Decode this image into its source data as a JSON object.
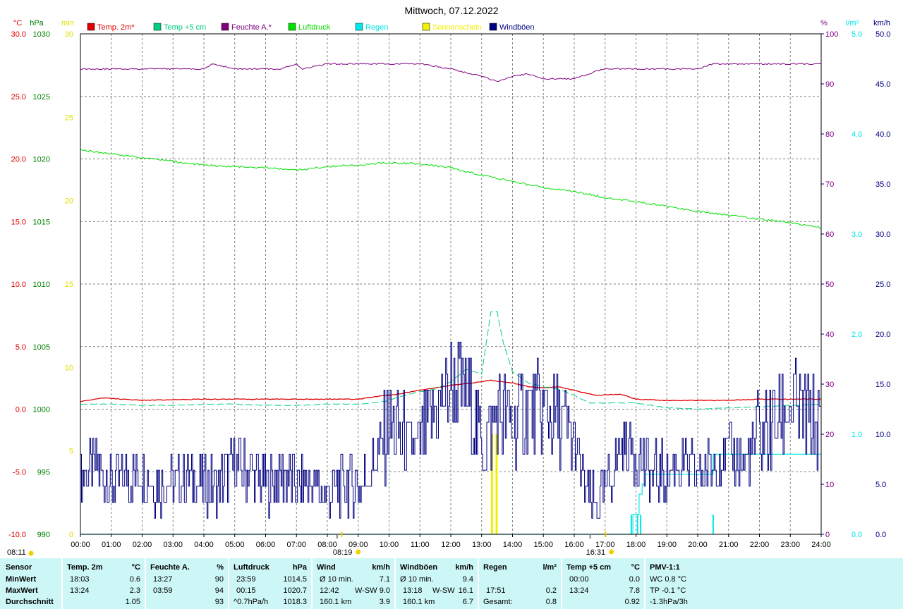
{
  "title": "Mittwoch, 07.12.2022",
  "legend": [
    {
      "name": "Temp. 2m*",
      "color": "#e00000"
    },
    {
      "name": "Temp +5 cm",
      "color": "#00d080"
    },
    {
      "name": "Feuchte A.*",
      "color": "#800080"
    },
    {
      "name": "Luftdruck",
      "color": "#00e000"
    },
    {
      "name": "Regen",
      "color": "#00e8e8"
    },
    {
      "name": "Sonnenschein",
      "color": "#f0f000"
    },
    {
      "name": "Windböen",
      "color": "#000080"
    }
  ],
  "chart_data": {
    "type": "line",
    "title": "Mittwoch, 07.12.2022",
    "x_ticks": [
      "00:00",
      "01:00",
      "02:00",
      "03:00",
      "04:00",
      "05:00",
      "06:00",
      "07:00",
      "08:00",
      "09:00",
      "10:00",
      "11:00",
      "12:00",
      "13:00",
      "14:00",
      "15:00",
      "16:00",
      "17:00",
      "18:00",
      "19:00",
      "20:00",
      "21:00",
      "22:00",
      "23:00",
      "24:00"
    ],
    "axes": {
      "temp": {
        "unit": "°C",
        "range": [
          -10,
          30
        ],
        "ticks": [
          "-10.0",
          "-5.0",
          "0.0",
          "5.0",
          "10.0",
          "15.0",
          "20.0",
          "25.0",
          "30.0"
        ],
        "color": "#e00000"
      },
      "pressure": {
        "unit": "hPa",
        "range": [
          990,
          1030
        ],
        "ticks": [
          "990",
          "995",
          "1000",
          "1005",
          "1010",
          "1015",
          "1020",
          "1025",
          "1030"
        ],
        "color": "#008000"
      },
      "sun": {
        "unit": "min",
        "range": [
          0,
          30
        ],
        "ticks": [
          "0",
          "5",
          "10",
          "15",
          "20",
          "25",
          "30"
        ],
        "color": "#e0e000"
      },
      "humidity": {
        "unit": "%",
        "range": [
          0,
          100
        ],
        "ticks": [
          "0",
          "10",
          "20",
          "30",
          "40",
          "50",
          "60",
          "70",
          "80",
          "90",
          "100"
        ],
        "color": "#800080"
      },
      "rain": {
        "unit": "l/m²",
        "range": [
          0,
          5
        ],
        "ticks": [
          "0.0",
          "1.0",
          "2.0",
          "3.0",
          "4.0",
          "5.0"
        ],
        "color": "#00e8e8"
      },
      "wind": {
        "unit": "km/h",
        "range": [
          0,
          50
        ],
        "ticks": [
          "0.0",
          "5.0",
          "10.0",
          "15.0",
          "20.0",
          "25.0",
          "30.0",
          "35.0",
          "40.0",
          "45.0",
          "50.0"
        ],
        "color": "#000080"
      }
    },
    "sunrise": "08:11",
    "sunset": "16:31",
    "sun_markers": [
      "08:19",
      "16:31"
    ],
    "grid": true,
    "legend_position": "top",
    "series": [
      {
        "name": "Feuchte A.*",
        "axis": "humidity",
        "color": "#800080",
        "x": [
          0,
          2,
          4,
          4.3,
          5,
          5.7,
          6.5,
          7,
          7.2,
          8,
          10,
          11,
          12,
          13,
          13.5,
          14,
          14.5,
          15,
          15.5,
          16,
          16.7,
          17,
          18,
          19,
          20,
          20.5,
          21,
          22,
          23,
          24
        ],
        "y": [
          93,
          93,
          93,
          94,
          93,
          93,
          93,
          94,
          93,
          94,
          94,
          94,
          93,
          91.5,
          90.5,
          91.5,
          92,
          91,
          91,
          91,
          92.5,
          93,
          93,
          93,
          93,
          94,
          94,
          94,
          94,
          94
        ]
      },
      {
        "name": "Luftdruck",
        "axis": "pressure",
        "color": "#00e000",
        "x": [
          0,
          1,
          2,
          3,
          4,
          5,
          6,
          7,
          8,
          9,
          10,
          11,
          12,
          13,
          14,
          15,
          16,
          17,
          18,
          19,
          20,
          21,
          22,
          23,
          24
        ],
        "y": [
          1020.7,
          1020.4,
          1020.1,
          1019.8,
          1019.5,
          1019.4,
          1019.3,
          1019.1,
          1019.4,
          1019.5,
          1019.7,
          1019.6,
          1019.3,
          1018.7,
          1018.2,
          1017.7,
          1017.4,
          1016.9,
          1016.6,
          1016.2,
          1015.8,
          1015.5,
          1015.2,
          1014.9,
          1014.5
        ]
      },
      {
        "name": "Temp. 2m*",
        "axis": "temp",
        "color": "#e00000",
        "x": [
          0,
          0.7,
          2,
          4,
          6,
          8,
          9,
          9.5,
          10,
          11,
          12,
          12.7,
          13.3,
          14,
          14.5,
          15,
          15.5,
          16,
          16.7,
          17.5,
          18,
          19,
          20,
          21,
          22,
          23,
          24
        ],
        "y": [
          0.6,
          0.9,
          0.7,
          0.8,
          0.8,
          0.8,
          0.8,
          1.0,
          1.1,
          1.5,
          1.9,
          2.1,
          2.3,
          2.1,
          1.8,
          1.7,
          1.8,
          1.5,
          1.1,
          1.2,
          0.8,
          0.7,
          0.7,
          0.7,
          0.8,
          0.8,
          0.8
        ]
      },
      {
        "name": "Temp +5 cm",
        "axis": "temp",
        "color": "#00d080",
        "dashed": true,
        "x": [
          0,
          1,
          2,
          3,
          4,
          5,
          6,
          7,
          8,
          9,
          9.5,
          10,
          10.5,
          11,
          11.5,
          12,
          12.5,
          13,
          13.3,
          13.5,
          13.7,
          14,
          14.5,
          15,
          15.5,
          16,
          16.5,
          17,
          18,
          19,
          20,
          21,
          22,
          23,
          24
        ],
        "y": [
          0.4,
          0.4,
          0.3,
          0.3,
          0.4,
          0.4,
          0.3,
          0.3,
          0.4,
          0.4,
          0.5,
          0.7,
          1.1,
          1.4,
          1.6,
          2.2,
          3.2,
          2.8,
          7.8,
          7.8,
          5.3,
          3.0,
          2.1,
          1.8,
          1.6,
          1.1,
          0.5,
          0.5,
          0.5,
          0.1,
          0.0,
          0.1,
          0.2,
          0.3,
          0.4
        ]
      },
      {
        "name": "Regen",
        "axis": "rain",
        "color": "#00e8e8",
        "x": [
          0,
          17.8,
          17.9,
          18.1,
          18.2,
          18.3,
          20.45,
          20.5,
          21,
          24
        ],
        "y": [
          0,
          0,
          0.2,
          0.4,
          0.5,
          0.6,
          0.6,
          0.8,
          0.8,
          0.8
        ]
      },
      {
        "name": "Sonnenschein",
        "axis": "sun",
        "color": "#f0f000",
        "type": "bar",
        "x": [
          13.3,
          13.45
        ],
        "y": [
          6,
          6
        ]
      },
      {
        "name": "Windböen",
        "axis": "wind",
        "color": "#000080",
        "x": [
          0,
          0.5,
          1,
          1.5,
          2,
          2.5,
          3,
          3.5,
          4,
          4.5,
          5,
          5.5,
          6,
          6.5,
          7,
          7.5,
          8,
          8.5,
          9,
          9.5,
          10,
          10.5,
          11,
          11.5,
          12,
          12.5,
          13,
          13.5,
          14,
          14.5,
          15,
          15.5,
          16,
          16.5,
          17,
          17.5,
          18,
          18.5,
          19,
          19.5,
          20,
          20.5,
          21,
          21.5,
          22,
          22.5,
          23,
          23.5,
          24
        ],
        "y": [
          6,
          7,
          5,
          6,
          6,
          5,
          5,
          6,
          5,
          5,
          7,
          6,
          5,
          6,
          5,
          5,
          4,
          5,
          5,
          7,
          11,
          9,
          9,
          12,
          15,
          14,
          9,
          12,
          11,
          13,
          12,
          11,
          9,
          3,
          4,
          9,
          8,
          6,
          6,
          7,
          6,
          7,
          8,
          7,
          10,
          11,
          13,
          12,
          10
        ]
      }
    ]
  },
  "stats": {
    "sensor": {
      "header": "Sensor",
      "rows": [
        "MinWert",
        "MaxWert",
        "Durchschnitt"
      ]
    },
    "temp2m": {
      "header": "Temp. 2m",
      "unit": "°C",
      "min_time": "18:03",
      "min_val": "0.6",
      "max_time": "13:24",
      "max_val": "2.3",
      "avg_val": "1.05"
    },
    "feuchte": {
      "header": "Feuchte A.",
      "unit": "%",
      "min_time": "13:27",
      "min_val": "90",
      "max_time": "03:59",
      "max_val": "94",
      "avg_val": "93"
    },
    "luftdruck": {
      "header": "Luftdruck",
      "unit": "hPa",
      "min_time": "23:59",
      "min_val": "1014.5",
      "max_time": "00:15",
      "max_val": "1020.7",
      "avg_label": "^0.7hPa/h",
      "avg_val": "1018.3"
    },
    "wind": {
      "header": "Wind",
      "unit": "km/h",
      "min_label": "Ø 10 min.",
      "min_val": "7.1",
      "max_time": "12:42",
      "max_dir": "W-SW",
      "max_val": "9.0",
      "avg_label": "160.1 km",
      "avg_val": "3.9"
    },
    "windboen": {
      "header": "Windböen",
      "unit": "km/h",
      "min_label": "Ø 10 min.",
      "min_val": "9.4",
      "max_time": "13:18",
      "max_dir": "W-SW",
      "max_val": "16.1",
      "avg_label": "160.1 km",
      "avg_val": "6.7"
    },
    "regen": {
      "header": "Regen",
      "unit": "l/m²",
      "max_time": "17:51",
      "max_val": "0.2",
      "avg_label": "Gesamt:",
      "avg_val": "0.8"
    },
    "temp5cm": {
      "header": "Temp +5 cm",
      "unit": "°C",
      "min_time": "00:00",
      "min_val": "0.0",
      "max_time": "13:24",
      "max_val": "7.8",
      "avg_val": "0.92"
    },
    "pmv": {
      "header": "PMV-1:1",
      "row1": "WC 0.8 °C",
      "row2": "TP -0.1 °C",
      "row3": "-1.3hPa/3h"
    }
  }
}
